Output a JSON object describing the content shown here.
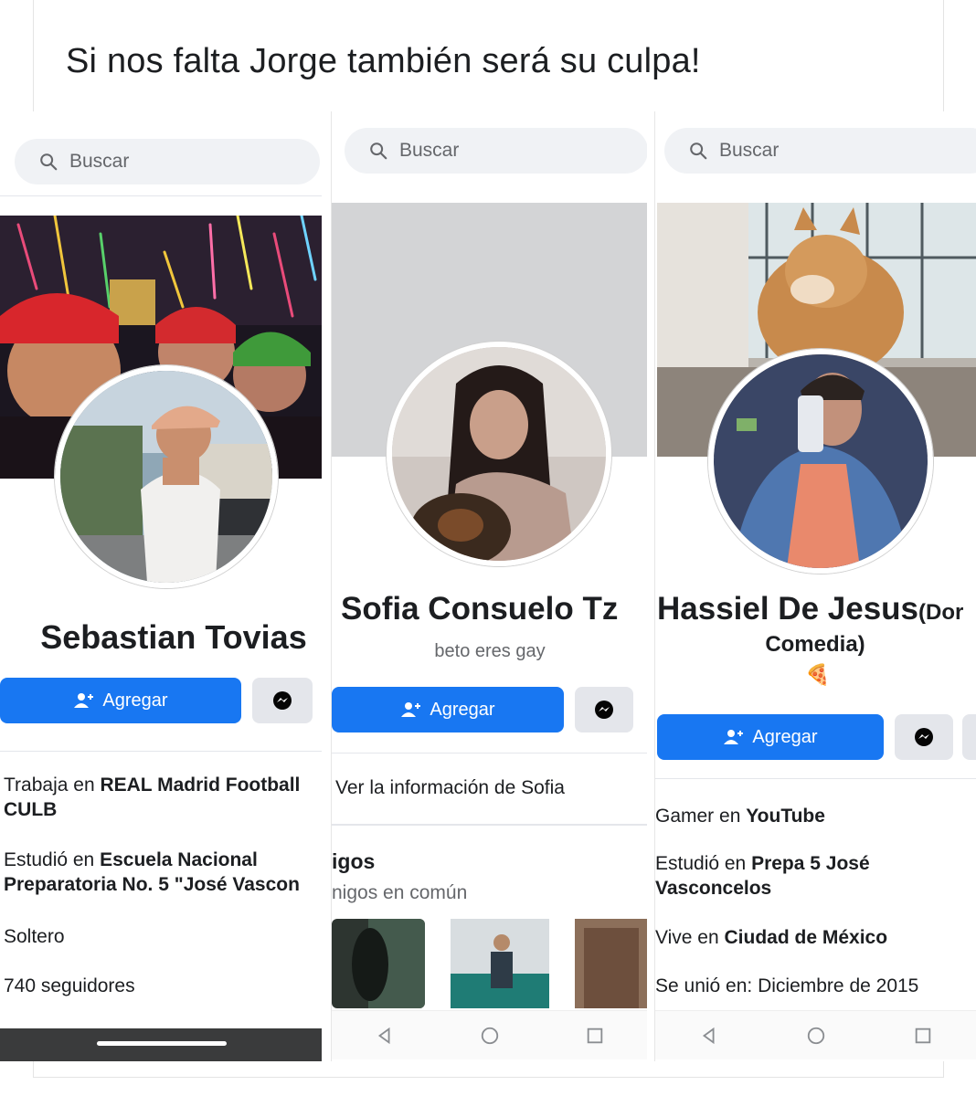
{
  "caption": "Si nos falta Jorge también será su culpa!",
  "profiles": [
    {
      "search_placeholder": "Buscar",
      "name": "Sebastian Tovias",
      "add_label": "Agregar",
      "info": [
        {
          "prefix": "Trabaja en ",
          "bold": "REAL Madrid Football",
          "line2": "CULB"
        },
        {
          "prefix": "Estudió en ",
          "bold": "Escuela Nacional",
          "line2": "Preparatoria No. 5 \"José Vascon"
        },
        {
          "prefix": "Soltero"
        },
        {
          "prefix": "740 seguidores"
        }
      ]
    },
    {
      "search_placeholder": "Buscar",
      "name": "Sofia Consuelo Tz",
      "bio": "beto eres gay",
      "add_label": "Agregar",
      "see_info": "Ver la información de Sofia",
      "friends_title": "igos",
      "friends_sub": "nigos en común"
    },
    {
      "search_placeholder": "Buscar",
      "name": "Hassiel De Jesus",
      "name_suffix": "(Dor",
      "name_line2": "Comedia)",
      "emoji": "🍕",
      "add_label": "Agregar",
      "info": [
        {
          "prefix": "Gamer en ",
          "bold": "YouTube"
        },
        {
          "prefix": "Estudió en ",
          "bold": "Prepa 5 José",
          "line2": "Vasconcelos"
        },
        {
          "prefix": "Vive en ",
          "bold": "Ciudad de México"
        },
        {
          "prefix": "Se unió en: Diciembre de 2015"
        }
      ]
    }
  ],
  "icons": {
    "search": "search-icon",
    "add_friend": "add-friend-icon",
    "messenger": "messenger-icon",
    "nav_back": "back-triangle-icon",
    "nav_home": "home-circle-icon",
    "nav_recent": "recent-square-icon"
  },
  "colors": {
    "facebook_blue": "#1877f2",
    "secondary_button": "#e4e6eb",
    "search_bg": "#f0f2f5",
    "muted_text": "#65676b"
  }
}
